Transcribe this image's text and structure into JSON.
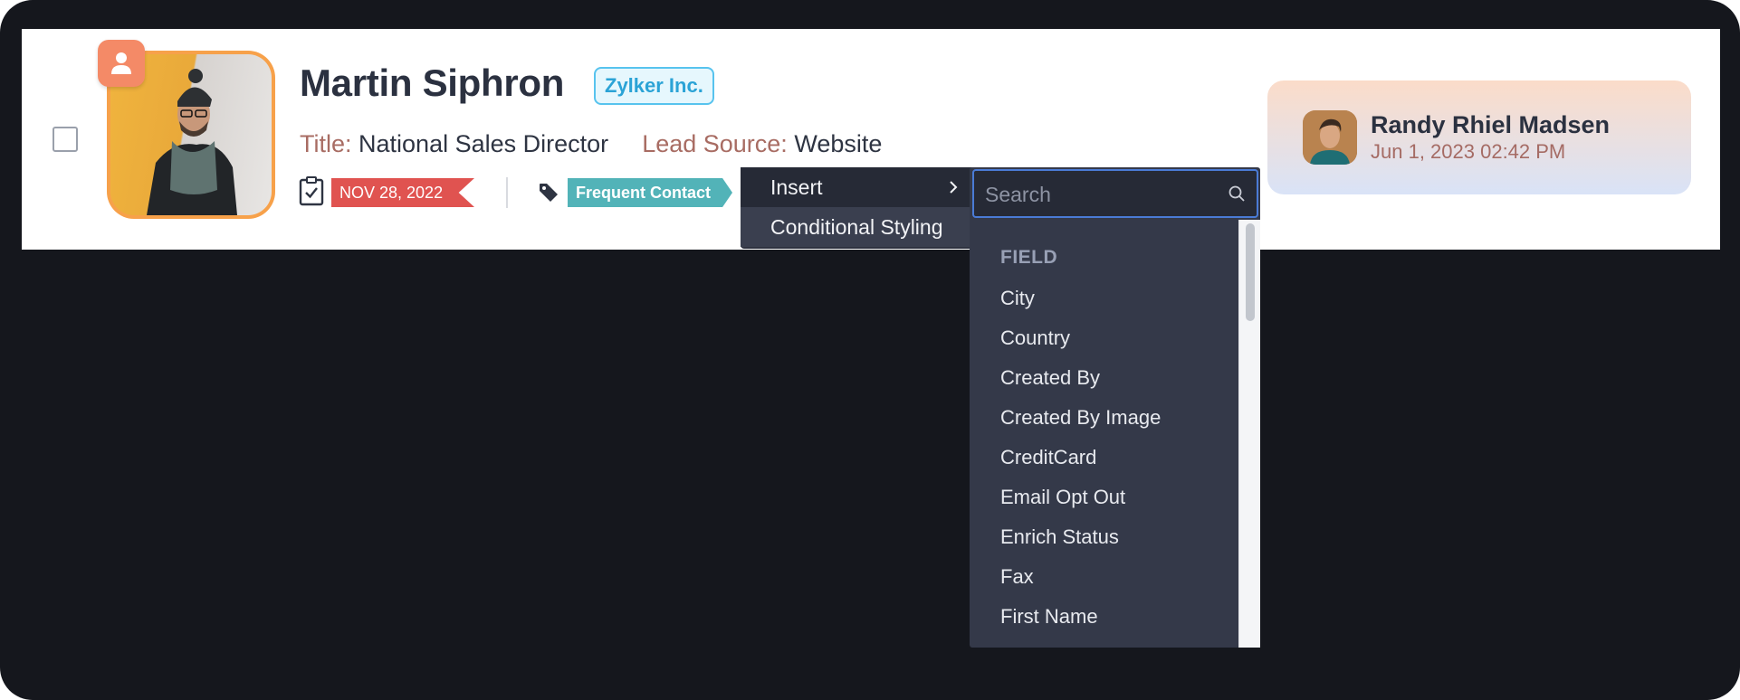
{
  "lead": {
    "name": "Martin Siphron",
    "company": "Zylker Inc.",
    "title_label": "Title:",
    "title_value": "National Sales Director",
    "source_label": "Lead Source:",
    "source_value": "Website",
    "task_date": "NOV 28, 2022",
    "tag": "Frequent Contact"
  },
  "owner": {
    "name": "Randy Rhiel Madsen",
    "timestamp": "Jun 1, 2023 02:42 PM"
  },
  "context_menu": {
    "insert_label": "Insert",
    "conditional_label": "Conditional Styling"
  },
  "submenu": {
    "search_placeholder": "Search",
    "section_header": "FIELD",
    "items": [
      "City",
      "Country",
      "Created By",
      "Created By Image",
      "CreditCard",
      "Email Opt Out",
      "Enrich Status",
      "Fax",
      "First Name"
    ]
  },
  "colors": {
    "accent_orange": "#f48a67",
    "date_tag": "#e05350",
    "tag_pill": "#52b3b8",
    "company_badge": "#57c3ee",
    "menu_bg": "#2e3240"
  },
  "icons": [
    "user-icon",
    "task-icon",
    "tag-icon",
    "chevron-right-icon",
    "search-icon"
  ]
}
